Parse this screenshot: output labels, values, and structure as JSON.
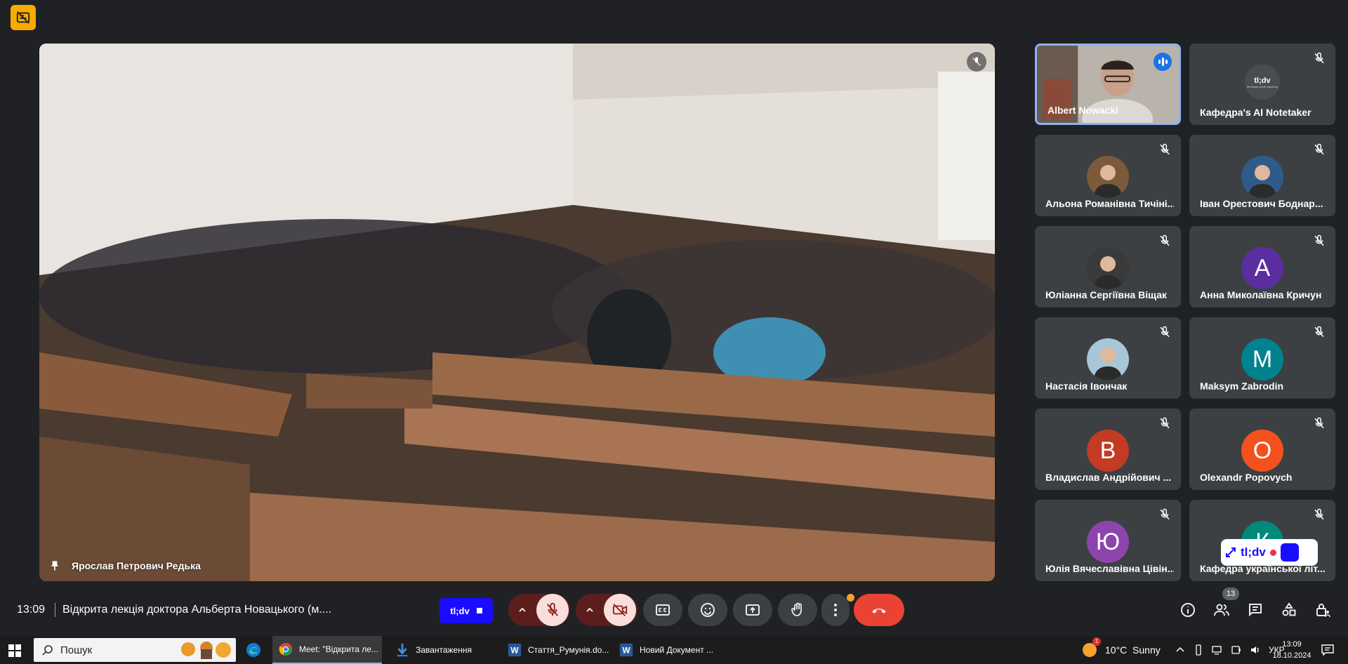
{
  "main_speaker": {
    "name": "Ярослав Петрович Редька"
  },
  "participants": [
    {
      "name": "Albert Nowacki",
      "kind": "video",
      "speaking": true
    },
    {
      "name": "Кафедра's AI Notetaker",
      "kind": "tldv",
      "logo_text": "tl;dv",
      "logo_sub": "Meetings worth watching"
    },
    {
      "name": "Альона Романівна Тичіні...",
      "kind": "photo",
      "color": "#7a5a3a"
    },
    {
      "name": "Іван Орестович Боднар...",
      "kind": "photo",
      "color": "#2f5b8a"
    },
    {
      "name": "Юліанна Сергіївна Віщак",
      "kind": "photo",
      "color": "#3a3a3a"
    },
    {
      "name": "Анна Миколаївна Кричун",
      "kind": "letter",
      "letter": "А",
      "color": "#5b2e9f"
    },
    {
      "name": "Настасія Івончак",
      "kind": "photo",
      "color": "#a8c6d8"
    },
    {
      "name": "Maksym Zabrodin",
      "kind": "letter",
      "letter": "M",
      "color": "#00838f"
    },
    {
      "name": "Владислав Андрійович ...",
      "kind": "letter",
      "letter": "В",
      "color": "#c23b22"
    },
    {
      "name": "Olexandr Popovych",
      "kind": "letter",
      "letter": "O",
      "color": "#f4511e"
    },
    {
      "name": "Юлія Вячеславівна Цівін...",
      "kind": "letter",
      "letter": "Ю",
      "color": "#8e44ad"
    },
    {
      "name": "Кафедра української літ...",
      "kind": "letter",
      "letter": "К",
      "color": "#00897b"
    }
  ],
  "tldv_widget": {
    "label": "tl;dv"
  },
  "controls": {
    "time": "13:09",
    "meeting_title": "Відкрита лекція доктора Альберта Новацького (м....",
    "tldv_label": "tl;dv",
    "people_count": "13"
  },
  "taskbar": {
    "search_placeholder": "Пошук",
    "apps": [
      {
        "label": "Meet: \"Відкрита ле...",
        "icon": "chrome-icon",
        "active": true
      },
      {
        "label": "Завантаження",
        "icon": "download-icon",
        "active": false
      },
      {
        "label": "Стаття_Румунія.do...",
        "icon": "word-icon",
        "active": false
      },
      {
        "label": "Новий Документ ...",
        "icon": "word-icon",
        "active": false
      }
    ],
    "weather": "10°C  Sunny",
    "weather_badge": "1",
    "language": "УКР",
    "clock_time": "13:09",
    "clock_date": "18.10.2024"
  },
  "colors": {
    "background": "#202124",
    "tile": "#3c4043",
    "end_call": "#ea4335",
    "active_border": "#8ab4f8",
    "tldv_blue": "#1a0dff"
  }
}
